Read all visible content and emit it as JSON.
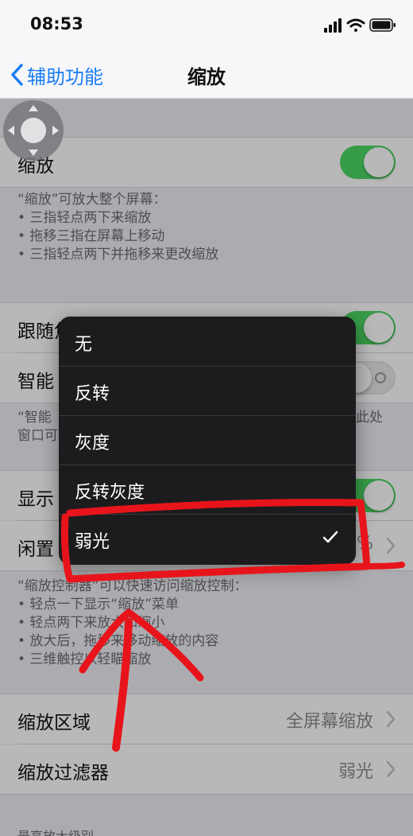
{
  "status_bar": {
    "time": "08:53"
  },
  "nav": {
    "back_label": "辅助功能",
    "title": "缩放"
  },
  "zoom_row": {
    "label": "缩放",
    "toggle": "on"
  },
  "zoom_footer": [
    "“缩放”可放大整个屏幕：",
    "• 三指轻点两下来缩放",
    "• 拖移三指在屏幕上移动",
    "• 三指轻点两下并拖移来更改缩放"
  ],
  "follow_focus_row": {
    "label": "跟随焦",
    "toggle": "on"
  },
  "smart_row": {
    "label": "智能",
    "toggle": "off"
  },
  "smart_footer": [
    "“智能",
    "窗口可"
  ],
  "smart_footer_right": "此处",
  "show_row": {
    "label": "显示",
    "toggle": "on"
  },
  "idle_row": {
    "label": "闲置",
    "value": "%"
  },
  "controller_footer": [
    "“缩放控制器”可以快速访问缩放控制：",
    "• 轻点一下显示“缩放”菜单",
    "• 轻点两下来放大和缩小",
    "• 放大后，拖移来移动缩放的内容",
    "• 三维触控以轻瞄缩放"
  ],
  "zoom_region_row": {
    "label": "缩放区域",
    "value": "全屏幕缩放"
  },
  "zoom_filter_row": {
    "label": "缩放过滤器",
    "value": "弱光"
  },
  "max_zoom_header": "最高放大级别",
  "filter_menu": {
    "items": [
      {
        "label": "无",
        "selected": false
      },
      {
        "label": "反转",
        "selected": false
      },
      {
        "label": "灰度",
        "selected": false
      },
      {
        "label": "反转灰度",
        "selected": false
      },
      {
        "label": "弱光",
        "selected": true
      }
    ]
  },
  "colors": {
    "accent": "#1a7cf5",
    "toggle_on": "#4cd964",
    "annotation": "#e8141b",
    "menu_bg": "#1c1c1e"
  }
}
